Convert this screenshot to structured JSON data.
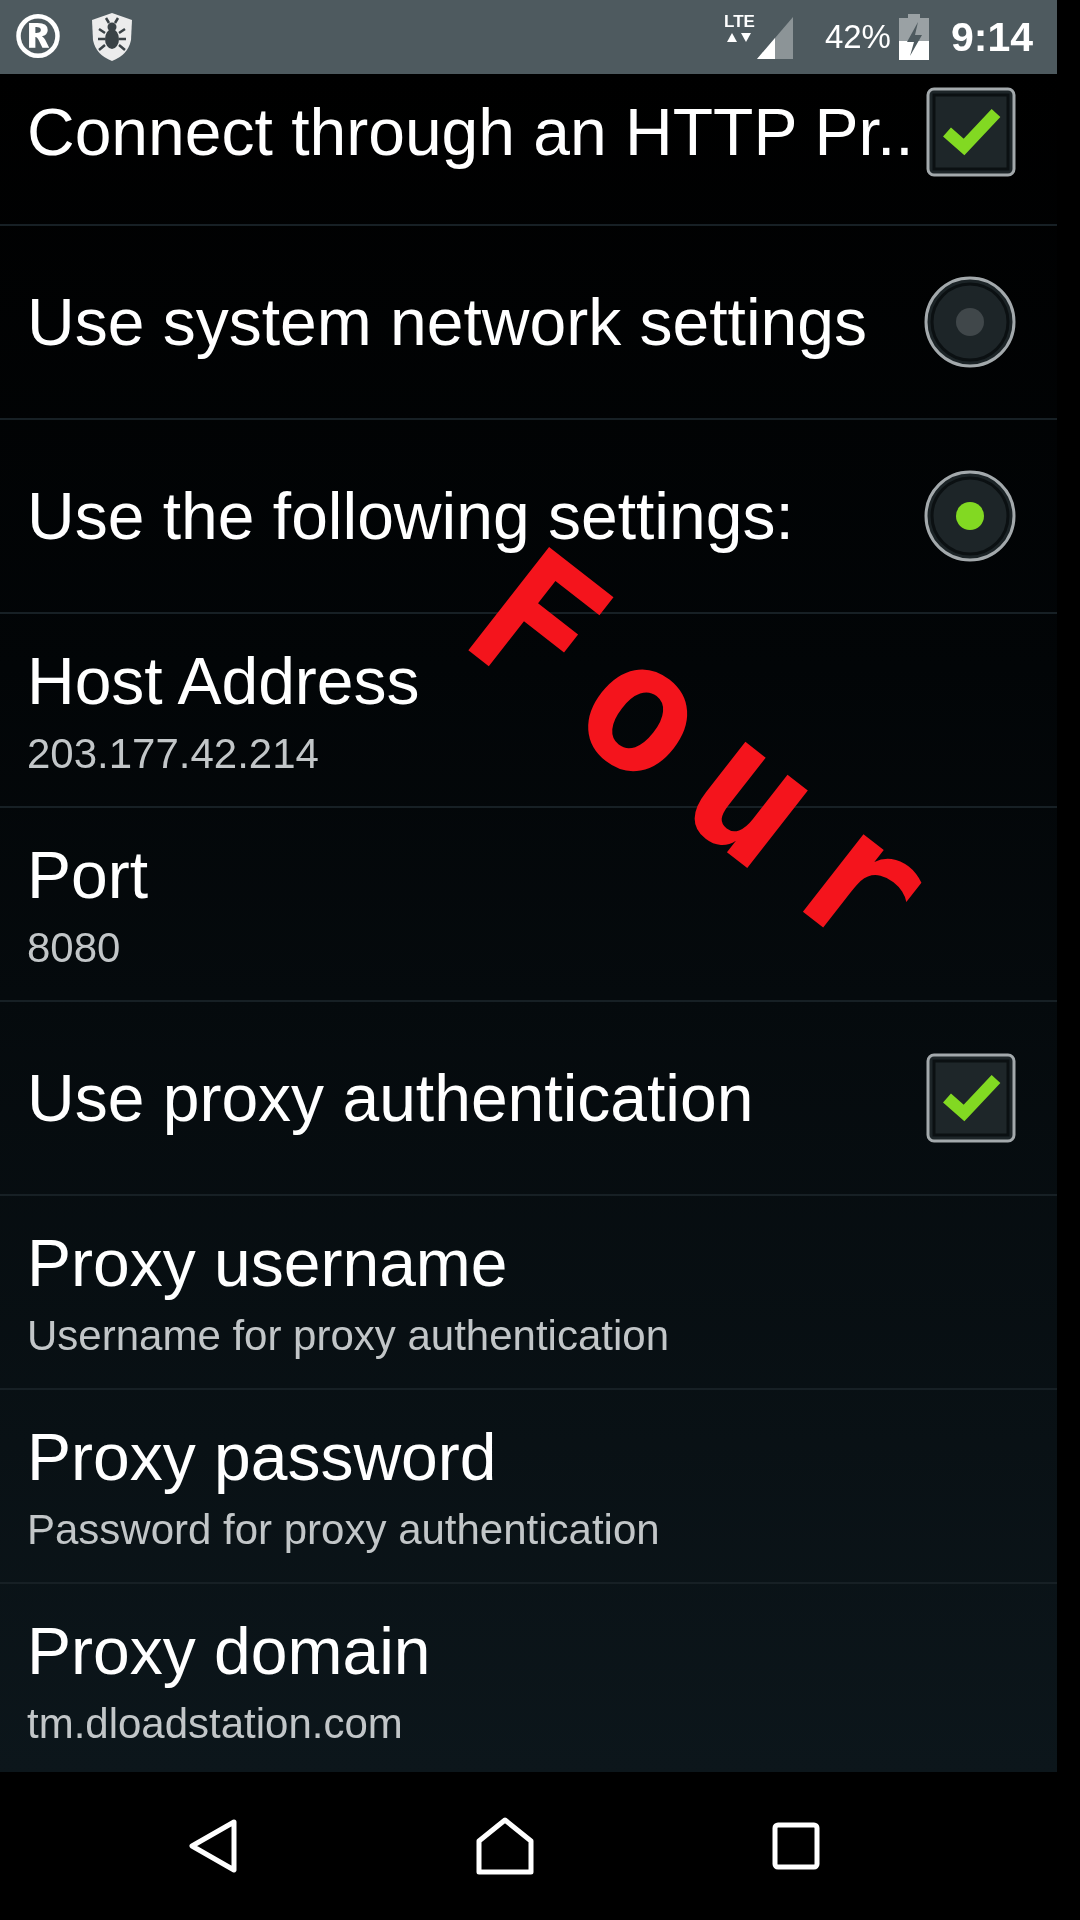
{
  "status_bar": {
    "registered_mark": "®",
    "network_type": "LTE",
    "battery": "42%",
    "time": "9:14"
  },
  "settings": [
    {
      "kind": "checkbox",
      "title": "Connect through an HTTP Pr..",
      "checked": true
    },
    {
      "kind": "radio",
      "title": "Use system network settings",
      "selected": false
    },
    {
      "kind": "radio",
      "title": "Use the following settings:",
      "selected": true
    },
    {
      "kind": "field",
      "title": "Host Address",
      "summary": "203.177.42.214"
    },
    {
      "kind": "field",
      "title": "Port",
      "summary": "8080"
    },
    {
      "kind": "checkbox",
      "title": "Use proxy authentication",
      "checked": true
    },
    {
      "kind": "field",
      "title": "Proxy username",
      "summary": "Username for proxy authentication"
    },
    {
      "kind": "field",
      "title": "Proxy password",
      "summary": "Password for proxy authentication"
    },
    {
      "kind": "field",
      "title": "Proxy domain",
      "summary": "tm.dloadstation.com"
    }
  ],
  "annotation": {
    "text": "Four"
  }
}
